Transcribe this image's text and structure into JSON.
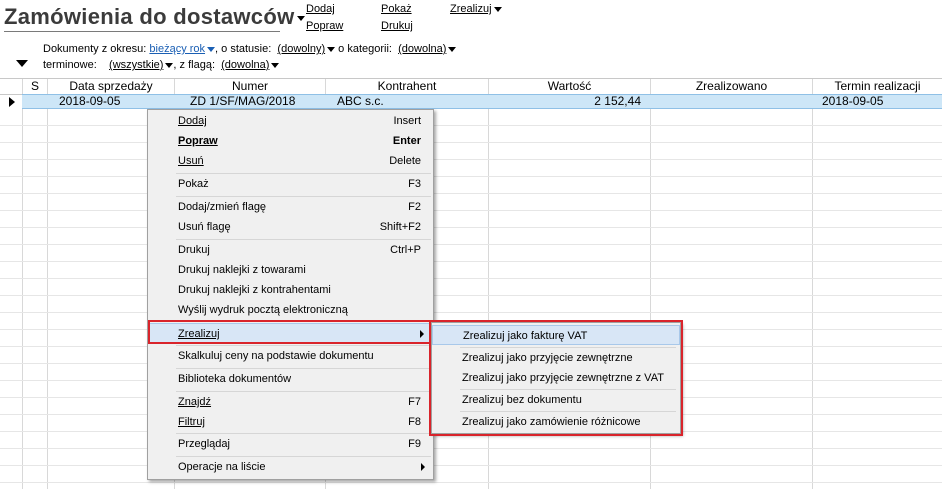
{
  "header": {
    "title": "Zamówienia do dostawców",
    "links": {
      "dodaj": "Dodaj",
      "popraw": "Popraw",
      "pokaz": "Pokaż",
      "drukuj": "Drukuj",
      "zrealizuj": "Zrealizuj"
    }
  },
  "filters": {
    "period_label": "Dokumenty z okresu:",
    "period_value": "bieżący rok",
    "status_label": ", o statusie:",
    "status_value": "(dowolny)",
    "category_label": "o kategorii:",
    "category_value": "(dowolna)",
    "terminowe_label": "terminowe:",
    "terminowe_value": "(wszystkie)",
    "flag_label": ", z flagą:",
    "flag_value": "(dowolna)"
  },
  "grid": {
    "columns": [
      "S",
      "Data sprzedaży",
      "Numer",
      "Kontrahent",
      "Wartość",
      "Zrealizowano",
      "Termin realizacji"
    ],
    "rows": [
      {
        "status": "",
        "date": "2018-09-05",
        "number": "ZD 1/SF/MAG/2018",
        "contractor": "ABC s.c.",
        "value": "2 152,44",
        "realized": "",
        "due": "2018-09-05"
      }
    ]
  },
  "context_menu": {
    "items": [
      {
        "label": "Dodaj",
        "shortcut": "Insert"
      },
      {
        "label": "Popraw",
        "shortcut": "Enter"
      },
      {
        "label": "Usuń",
        "shortcut": "Delete"
      },
      {
        "label": "Pokaż",
        "shortcut": "F3"
      },
      {
        "label": "Dodaj/zmień flagę",
        "shortcut": "F2"
      },
      {
        "label": "Usuń flagę",
        "shortcut": "Shift+F2"
      },
      {
        "label": "Drukuj",
        "shortcut": "Ctrl+P"
      },
      {
        "label": "Drukuj naklejki z towarami",
        "shortcut": ""
      },
      {
        "label": "Drukuj naklejki z kontrahentami",
        "shortcut": ""
      },
      {
        "label": "Wyślij wydruk pocztą elektroniczną",
        "shortcut": ""
      },
      {
        "label": "Zrealizuj",
        "shortcut": ""
      },
      {
        "label": "Skalkuluj ceny na podstawie dokumentu",
        "shortcut": ""
      },
      {
        "label": "Biblioteka dokumentów",
        "shortcut": ""
      },
      {
        "label": "Znajdź",
        "shortcut": "F7"
      },
      {
        "label": "Filtruj",
        "shortcut": "F8"
      },
      {
        "label": "Przeglądaj",
        "shortcut": "F9"
      },
      {
        "label": "Operacje na liście",
        "shortcut": ""
      }
    ]
  },
  "submenu": {
    "items": [
      {
        "label": "Zrealizuj jako fakturę VAT"
      },
      {
        "label": "Zrealizuj jako przyjęcie zewnętrzne"
      },
      {
        "label": "Zrealizuj jako przyjęcie zewnętrzne z VAT"
      },
      {
        "label": "Zrealizuj bez dokumentu"
      },
      {
        "label": "Zrealizuj jako zamówienie różnicowe"
      }
    ]
  },
  "colors": {
    "highlight_red": "#d9242b",
    "selection_blue": "#cde6f7",
    "link_blue": "#1a5fb4"
  }
}
